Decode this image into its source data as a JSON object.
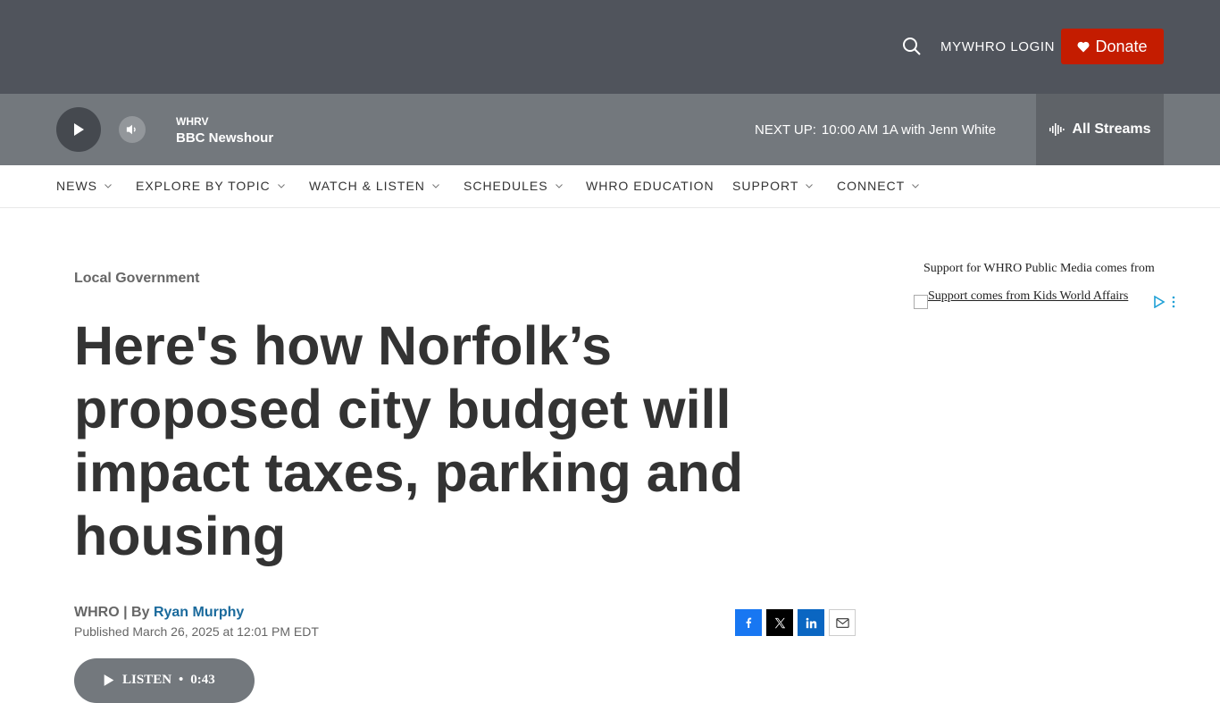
{
  "header": {
    "login_label": "MYWHRO LOGIN",
    "donate_label": "Donate",
    "donate_color": "#c41c00"
  },
  "player": {
    "station": "WHRV",
    "program": "BBC Newshour",
    "next_up_label": "NEXT UP:",
    "next_up_time": "10:00 AM",
    "next_up_show": "1A with Jenn White",
    "streams_label": "All Streams"
  },
  "nav": {
    "items": [
      {
        "label": "NEWS",
        "has_dropdown": true
      },
      {
        "label": "EXPLORE BY TOPIC",
        "has_dropdown": true
      },
      {
        "label": "WATCH & LISTEN",
        "has_dropdown": true
      },
      {
        "label": "SCHEDULES",
        "has_dropdown": true
      },
      {
        "label": "WHRO EDUCATION",
        "has_dropdown": false
      },
      {
        "label": "SUPPORT",
        "has_dropdown": true
      },
      {
        "label": "CONNECT",
        "has_dropdown": true
      }
    ]
  },
  "article": {
    "category": "Local Government",
    "headline": "Here's how Norfolk’s proposed city budget will impact taxes, parking and housing",
    "source": "WHRO",
    "by_label": "By",
    "author": "Ryan Murphy",
    "published": "Published March 26, 2025 at 12:01 PM EDT",
    "listen_label": "LISTEN",
    "listen_separator": "•",
    "listen_duration": "0:43"
  },
  "share": {
    "icons": [
      "facebook-icon",
      "x-icon",
      "linkedin-icon",
      "email-icon"
    ]
  },
  "sidebar": {
    "sponsor_label": "Support for WHRO Public Media comes from",
    "ad_alt_text": "Support comes from Kids World Affairs"
  }
}
